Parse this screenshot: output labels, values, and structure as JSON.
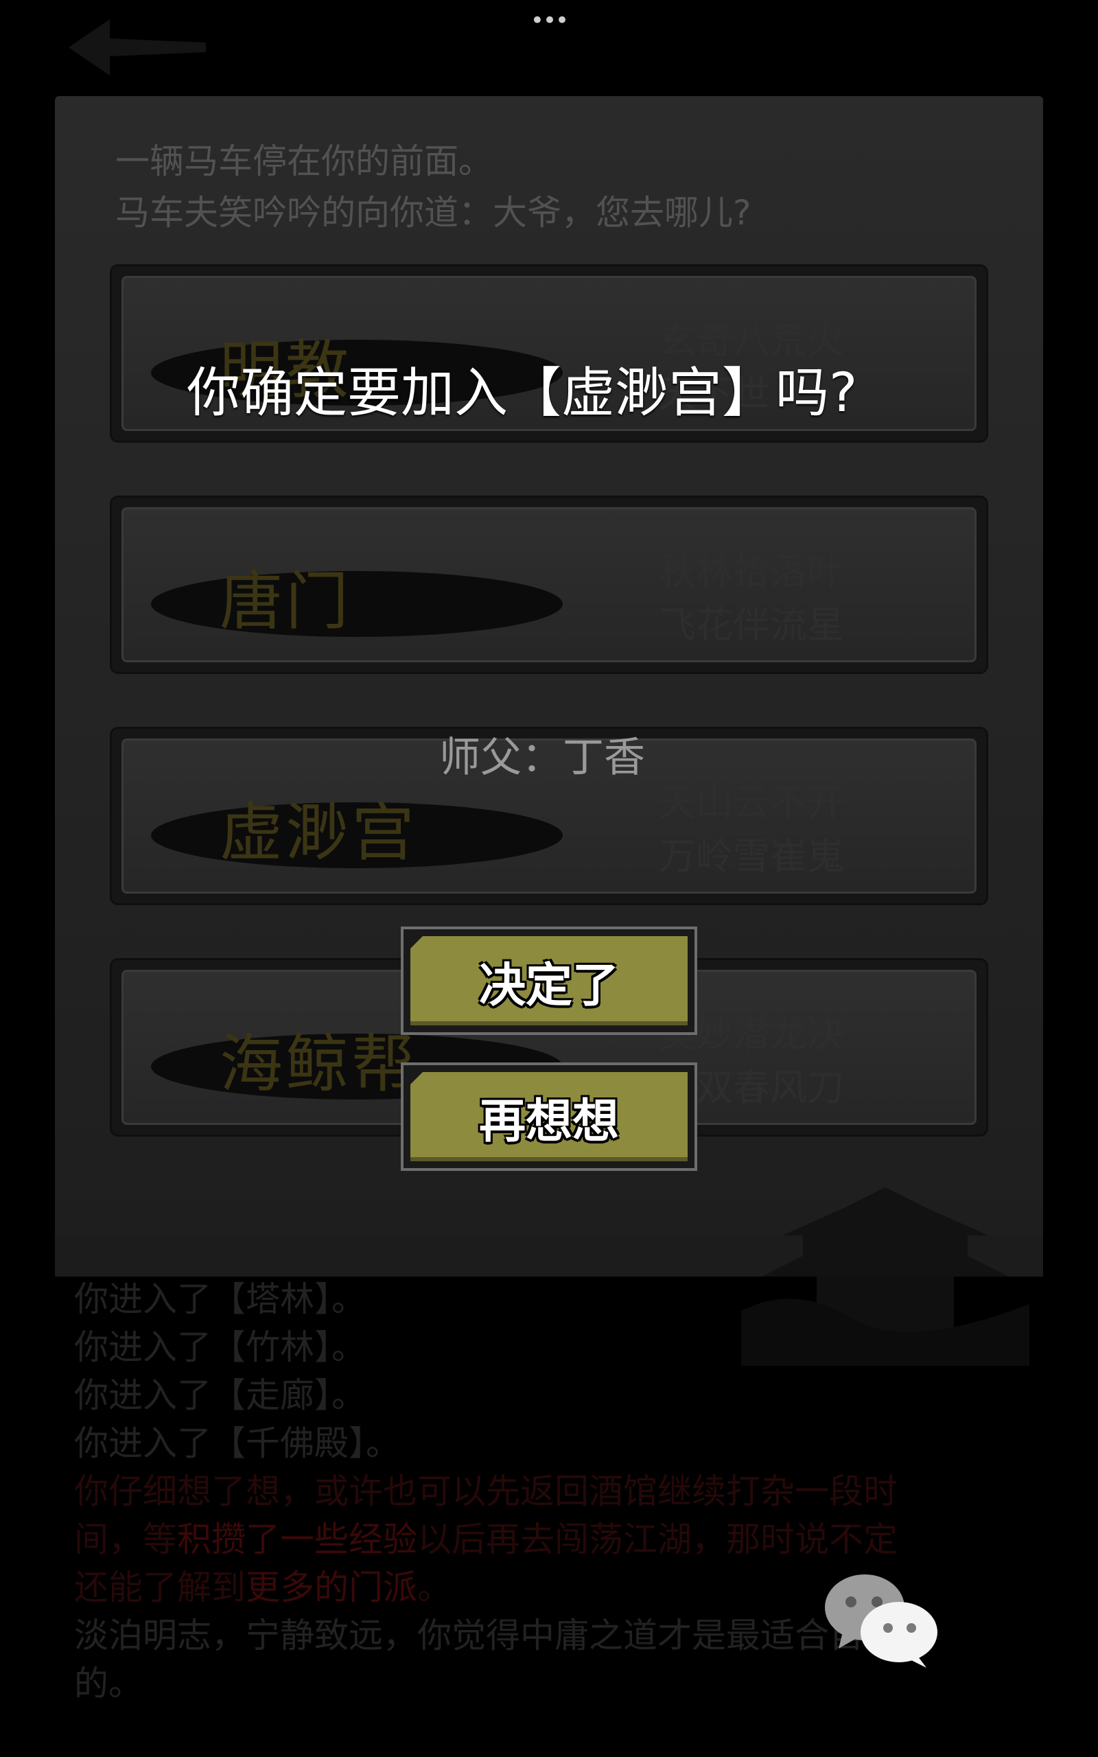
{
  "top_bar": {
    "more_icon": "more-dots-icon",
    "back_icon": "back-arrow-icon"
  },
  "intro": {
    "line1": "一辆马车停在你的前面。",
    "line2": "马车夫笑吟吟的向你道：大爷，您去哪儿?"
  },
  "sects": [
    {
      "name": "明教",
      "poem1": "玄奇八荒火",
      "poem2": "天下世"
    },
    {
      "name": "唐门",
      "poem1": "秋林拾落叶",
      "poem2": "飞花伴流星"
    },
    {
      "name": "虚渺宫",
      "poem1": "天山云不开",
      "poem2": "万岭雪崔嵬"
    },
    {
      "name": "海鲸帮",
      "poem1": "奥妙潜龙决",
      "poem2": "无双春风刀"
    }
  ],
  "dialog": {
    "question": "你确定要加入【虚渺宫】吗?",
    "master": "师父：丁香",
    "confirm_label": "决定了",
    "cancel_label": "再想想"
  },
  "log": {
    "l1": "你进入了【塔林】。",
    "l2": "你进入了【竹林】。",
    "l3": "你进入了【走廊】。",
    "l4": "你进入了【千佛殿】。",
    "p1": "你仔细想了想，或许也可以先返回酒馆继续打杂一段时",
    "p2a": "间，等",
    "p2b": "积攒了一些经验",
    "p2c": "以后再去闯荡江湖，那时说不定",
    "p3a": "还能了解到",
    "p3b": "更多的门派",
    "p3c": "。",
    "p4": "淡泊明志，宁静致远，你觉得中庸之道才是最适合自己",
    "p5": "的。"
  },
  "share_icon": "wechat-icon",
  "colors": {
    "button_face": "#8d8b3e",
    "dialog_text": "#ffffff",
    "dim_red": "#260808"
  }
}
